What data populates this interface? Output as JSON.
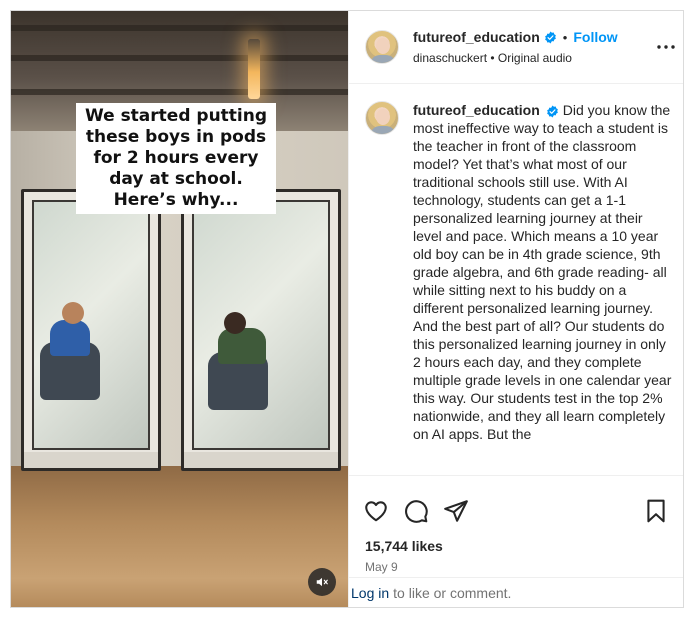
{
  "post": {
    "author": "futureof_education",
    "follow_label": "Follow",
    "separator": "•",
    "subtitle": "dinaschuckert • Original audio",
    "video_caption": "We started putting these boys in pods for 2 hours every day at school. Here’s why...",
    "caption": "Did you know the most ineffective way to teach a student is the teacher in front of the classroom model? Yet that’s what most of our traditional schools still use. With AI technology, students can get a 1-1 personalized learning journey at their level and pace. Which means a 10 year old boy can be in 4th grade science, 9th grade algebra, and 6th grade reading- all while sitting next to his buddy on a different personalized learning journey. And the best part of all? Our students do this personalized learning journey in only 2 hours each day, and they complete multiple grade levels in one calendar year this way. Our students test in the top 2% nationwide, and they all learn completely on AI apps. But the",
    "likes": "15,744 likes",
    "date": "May 9"
  },
  "footer": {
    "login_link": "Log in",
    "login_rest": "to like or comment."
  },
  "icons": {
    "verified": "verified-badge-icon",
    "more": "more-options-icon",
    "like": "heart-icon",
    "comment": "comment-bubble-icon",
    "share": "paper-plane-icon",
    "save": "bookmark-icon",
    "mute": "speaker-muted-icon"
  },
  "colors": {
    "accent": "#0095f6",
    "link": "#00376b",
    "muted_text": "#737373",
    "border": "#dbdbdb"
  }
}
